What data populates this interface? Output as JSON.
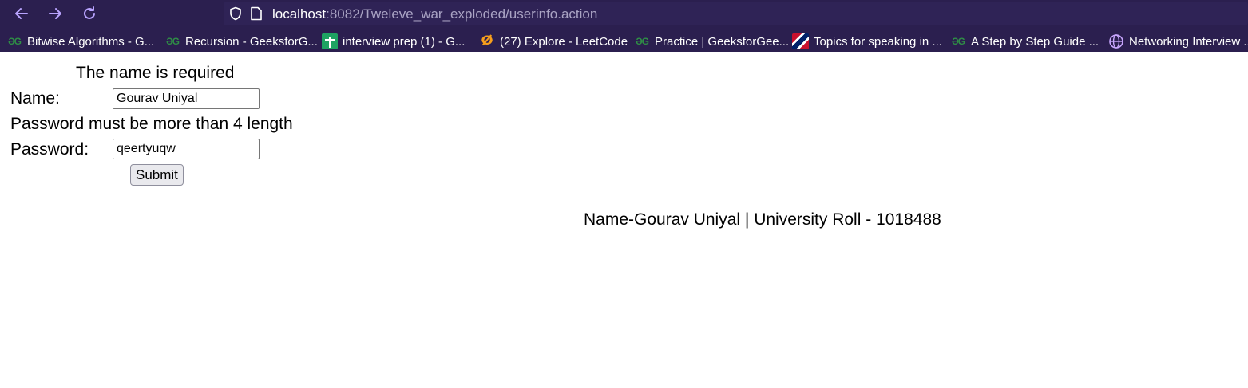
{
  "browser": {
    "url_host": "localhost",
    "url_rest": ":8082/Tweleve_war_exploded/userinfo.action",
    "bookmarks": [
      {
        "label": "Bitwise Algorithms - G...",
        "icon": "geeksforgeeks-icon"
      },
      {
        "label": "Recursion - GeeksforG...",
        "icon": "geeksforgeeks-icon"
      },
      {
        "label": "interview prep (1) - G...",
        "icon": "google-sheets-icon"
      },
      {
        "label": "(27) Explore - LeetCode",
        "icon": "leetcode-icon"
      },
      {
        "label": "Practice | GeeksforGee...",
        "icon": "geeksforgeeks-icon"
      },
      {
        "label": "Topics for speaking in ...",
        "icon": "uk-flag-icon"
      },
      {
        "label": "A Step by Step Guide ...",
        "icon": "geeksforgeeks-icon"
      },
      {
        "label": "Networking Interview ...",
        "icon": "globe-icon"
      }
    ],
    "colors": {
      "chrome_bg": "#2b1f4f",
      "nav_icon": "#b9a4ff"
    }
  },
  "form": {
    "name_error": "The name is required",
    "name_label": "Name:",
    "name_value": "Gourav Uniyal",
    "password_error": "Password must be more than 4 length",
    "password_label": "Password:",
    "password_value": "qeertyuqw",
    "submit_label": "Submit"
  },
  "footer": {
    "text": "Name-Gourav Uniyal | University Roll - 1018488"
  }
}
